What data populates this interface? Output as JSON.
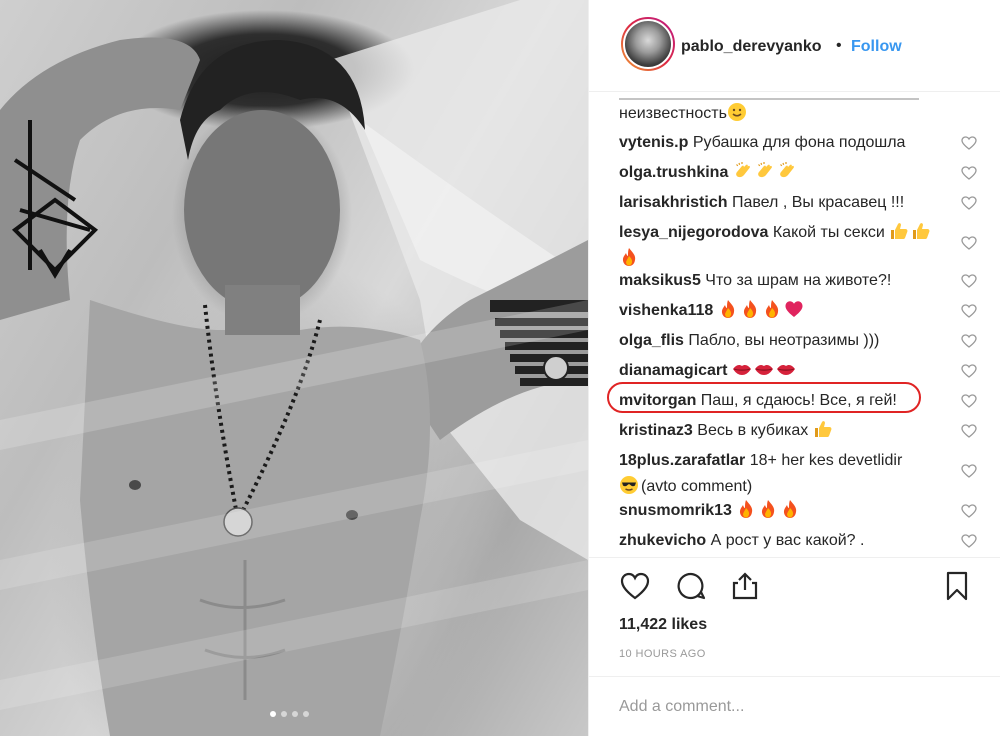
{
  "post": {
    "username": "pablo_derevyanko",
    "separator": "•",
    "follow_label": "Follow"
  },
  "comments": {
    "intro_text": "неизвестность",
    "items": [
      {
        "user": "vytenis.p",
        "text": "Рубашка для фона подошла",
        "emoji": []
      },
      {
        "user": "olga.trushkina",
        "text": "",
        "emoji": [
          "clap-emoji",
          "clap-emoji",
          "clap-emoji"
        ]
      },
      {
        "user": "larisakhristich",
        "text": "Павел , Вы красавец !!!",
        "emoji": []
      },
      {
        "user": "lesya_nijegorodova",
        "text": "Какой ты секси",
        "emoji": [
          "thumbs-up-emoji",
          "thumbs-up-emoji",
          "fire-emoji"
        ]
      },
      {
        "user": "maksikus5",
        "text": "Что за шрам на животе?!",
        "emoji": []
      },
      {
        "user": "vishenka118",
        "text": "",
        "emoji": [
          "fire-emoji",
          "fire-emoji",
          "fire-emoji",
          "red-heart-emoji"
        ]
      },
      {
        "user": "olga_flis",
        "text": "Пабло, вы неотразимы )))",
        "emoji": []
      },
      {
        "user": "dianamagicart",
        "text": "",
        "emoji": [
          "lips-emoji",
          "lips-emoji",
          "lips-emoji"
        ]
      },
      {
        "user": "mvitorgan",
        "text": "Паш, я сдаюсь! Все, я гей!",
        "emoji": []
      },
      {
        "user": "kristinaz3",
        "text": "Весь в кубиках",
        "emoji": [
          "thumbs-up-emoji"
        ]
      },
      {
        "user": "18plus.zarafatlar",
        "text": "18+ her kes devetlidir",
        "line2": "(avto comment)",
        "emoji": [
          "sunglasses-emoji"
        ]
      },
      {
        "user": "snusmomrik13",
        "text": "",
        "emoji": [
          "fire-emoji",
          "fire-emoji",
          "fire-emoji"
        ]
      },
      {
        "user": "zhukevicho",
        "text": "А рост у вас какой? .",
        "emoji": []
      }
    ]
  },
  "actions": {
    "icons": [
      "heart-icon",
      "comment-icon",
      "share-icon",
      "bookmark-icon"
    ],
    "likes": "11,422 likes",
    "time_ago": "10 HOURS AGO"
  },
  "add_comment": {
    "placeholder": "Add a comment..."
  },
  "carousel": {
    "dots": 4,
    "active_index": 0
  },
  "colors": {
    "link_blue": "#3897f0",
    "highlight_red": "#e02424",
    "text": "#262626",
    "muted": "#999999"
  }
}
